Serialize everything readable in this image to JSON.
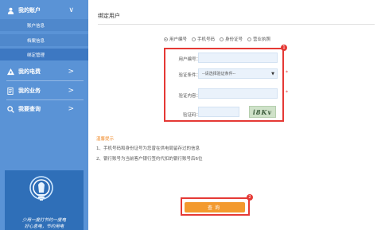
{
  "sidebar": {
    "my_account": "我的账户",
    "sub_items": [
      "账户信息",
      "档案信息",
      "绑定管理"
    ],
    "my_bill": "我的电费",
    "my_business": "我的业务",
    "my_query": "我要查询",
    "slogan_line1": "少用一度灯节约一度电",
    "slogan_line2": "好心息电，节约用电"
  },
  "main": {
    "title": "绑定用户",
    "radio_options": [
      "用户编号",
      "手机号码",
      "身份证号",
      "营业执照"
    ],
    "form": {
      "user_no_label": "用户编号：",
      "condition_label": "验证条件：",
      "condition_value": "--请选择验证条件--",
      "content_label": "验证内容：",
      "captcha_label": "验证码：",
      "captcha_text": "i8Kv",
      "required_mark": "*"
    },
    "tips_title": "温馨提示",
    "tips": [
      "1、手机号码和身份证号为您曾在供电局留存过的信息",
      "2、银行账号为当前客户银行签约代扣的银行账号后6位"
    ],
    "submit_label": "查询",
    "badge1": "1",
    "badge2": "2"
  },
  "colors": {
    "sidebar": "#5a93d6",
    "highlight": "#e53935",
    "button": "#f39a2e",
    "tips_title": "#f08c2c"
  }
}
